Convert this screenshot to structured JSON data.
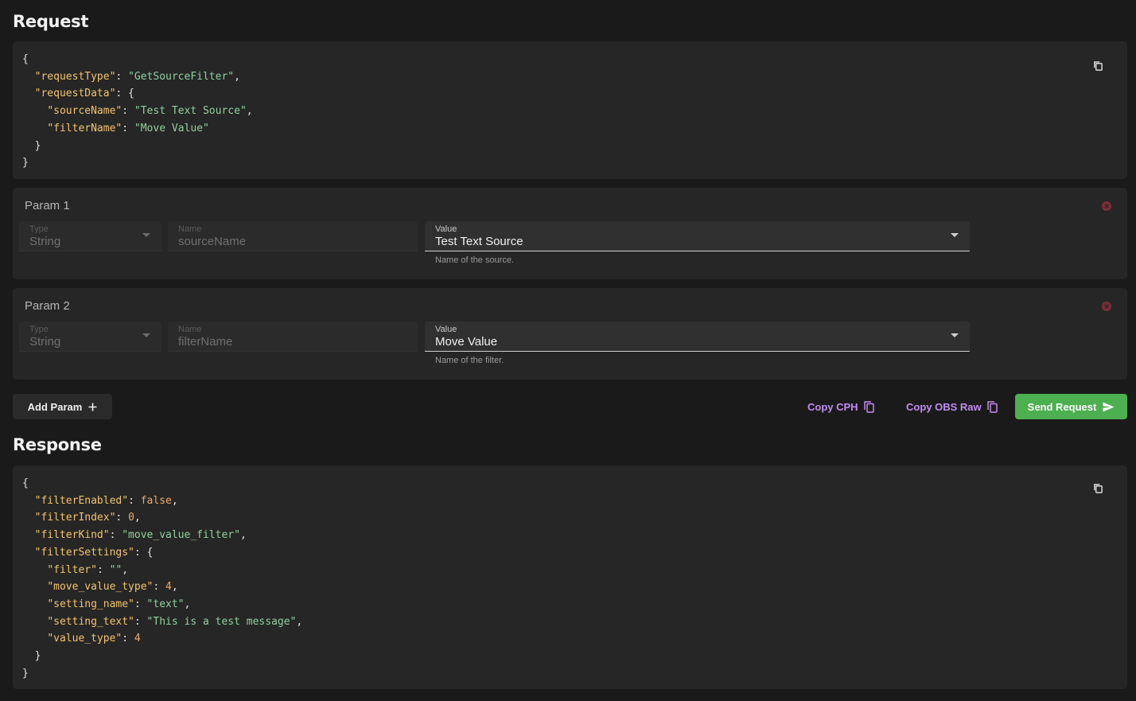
{
  "request": {
    "title": "Request",
    "code_lines": [
      [
        {
          "t": "p",
          "v": "{"
        }
      ],
      [
        {
          "t": "p",
          "v": "  "
        },
        {
          "t": "key",
          "v": "\"requestType\""
        },
        {
          "t": "p",
          "v": ": "
        },
        {
          "t": "str",
          "v": "\"GetSourceFilter\""
        },
        {
          "t": "p",
          "v": ","
        }
      ],
      [
        {
          "t": "p",
          "v": "  "
        },
        {
          "t": "key",
          "v": "\"requestData\""
        },
        {
          "t": "p",
          "v": ": {"
        }
      ],
      [
        {
          "t": "p",
          "v": "    "
        },
        {
          "t": "key",
          "v": "\"sourceName\""
        },
        {
          "t": "p",
          "v": ": "
        },
        {
          "t": "str",
          "v": "\"Test Text Source\""
        },
        {
          "t": "p",
          "v": ","
        }
      ],
      [
        {
          "t": "p",
          "v": "    "
        },
        {
          "t": "key",
          "v": "\"filterName\""
        },
        {
          "t": "p",
          "v": ": "
        },
        {
          "t": "str",
          "v": "\"Move Value\""
        }
      ],
      [
        {
          "t": "p",
          "v": "  }"
        }
      ],
      [
        {
          "t": "p",
          "v": "}"
        }
      ]
    ]
  },
  "params": [
    {
      "title": "Param 1",
      "type_label": "Type",
      "type_value": "String",
      "name_label": "Name",
      "name_value": "sourceName",
      "value_label": "Value",
      "value_value": "Test Text Source",
      "helper": "Name of the source."
    },
    {
      "title": "Param 2",
      "type_label": "Type",
      "type_value": "String",
      "name_label": "Name",
      "name_value": "filterName",
      "value_label": "Value",
      "value_value": "Move Value",
      "helper": "Name of the filter."
    }
  ],
  "actions": {
    "add_param": "Add Param",
    "copy_cph": "Copy CPH",
    "copy_obs_raw": "Copy OBS Raw",
    "send_request": "Send Request"
  },
  "response": {
    "title": "Response",
    "code_lines": [
      [
        {
          "t": "p",
          "v": "{"
        }
      ],
      [
        {
          "t": "p",
          "v": "  "
        },
        {
          "t": "key",
          "v": "\"filterEnabled\""
        },
        {
          "t": "p",
          "v": ": "
        },
        {
          "t": "bool",
          "v": "false"
        },
        {
          "t": "p",
          "v": ","
        }
      ],
      [
        {
          "t": "p",
          "v": "  "
        },
        {
          "t": "key",
          "v": "\"filterIndex\""
        },
        {
          "t": "p",
          "v": ": "
        },
        {
          "t": "num",
          "v": "0"
        },
        {
          "t": "p",
          "v": ","
        }
      ],
      [
        {
          "t": "p",
          "v": "  "
        },
        {
          "t": "key",
          "v": "\"filterKind\""
        },
        {
          "t": "p",
          "v": ": "
        },
        {
          "t": "str",
          "v": "\"move_value_filter\""
        },
        {
          "t": "p",
          "v": ","
        }
      ],
      [
        {
          "t": "p",
          "v": "  "
        },
        {
          "t": "key",
          "v": "\"filterSettings\""
        },
        {
          "t": "p",
          "v": ": {"
        }
      ],
      [
        {
          "t": "p",
          "v": "    "
        },
        {
          "t": "key",
          "v": "\"filter\""
        },
        {
          "t": "p",
          "v": ": "
        },
        {
          "t": "str",
          "v": "\"\""
        },
        {
          "t": "p",
          "v": ","
        }
      ],
      [
        {
          "t": "p",
          "v": "    "
        },
        {
          "t": "key",
          "v": "\"move_value_type\""
        },
        {
          "t": "p",
          "v": ": "
        },
        {
          "t": "num",
          "v": "4"
        },
        {
          "t": "p",
          "v": ","
        }
      ],
      [
        {
          "t": "p",
          "v": "    "
        },
        {
          "t": "key",
          "v": "\"setting_name\""
        },
        {
          "t": "p",
          "v": ": "
        },
        {
          "t": "str",
          "v": "\"text\""
        },
        {
          "t": "p",
          "v": ","
        }
      ],
      [
        {
          "t": "p",
          "v": "    "
        },
        {
          "t": "key",
          "v": "\"setting_text\""
        },
        {
          "t": "p",
          "v": ": "
        },
        {
          "t": "str",
          "v": "\"This is a test message\""
        },
        {
          "t": "p",
          "v": ","
        }
      ],
      [
        {
          "t": "p",
          "v": "    "
        },
        {
          "t": "key",
          "v": "\"value_type\""
        },
        {
          "t": "p",
          "v": ": "
        },
        {
          "t": "num",
          "v": "4"
        }
      ],
      [
        {
          "t": "p",
          "v": "  }"
        }
      ],
      [
        {
          "t": "p",
          "v": "}"
        }
      ]
    ]
  },
  "colors": {
    "background": "#1a1a1a",
    "card": "#262626",
    "json_key": "#f2c46d",
    "json_string": "#8fd19e",
    "json_number": "#f0a868",
    "accent_purple": "#c48cf0",
    "send_green": "#4caf50",
    "remove_icon": "#7a2e3a"
  },
  "icons": {
    "copy_code": "copy-icon",
    "remove_param": "close-circle-icon",
    "dropdown": "caret-down-icon",
    "add": "plus-icon",
    "send": "send-icon"
  }
}
